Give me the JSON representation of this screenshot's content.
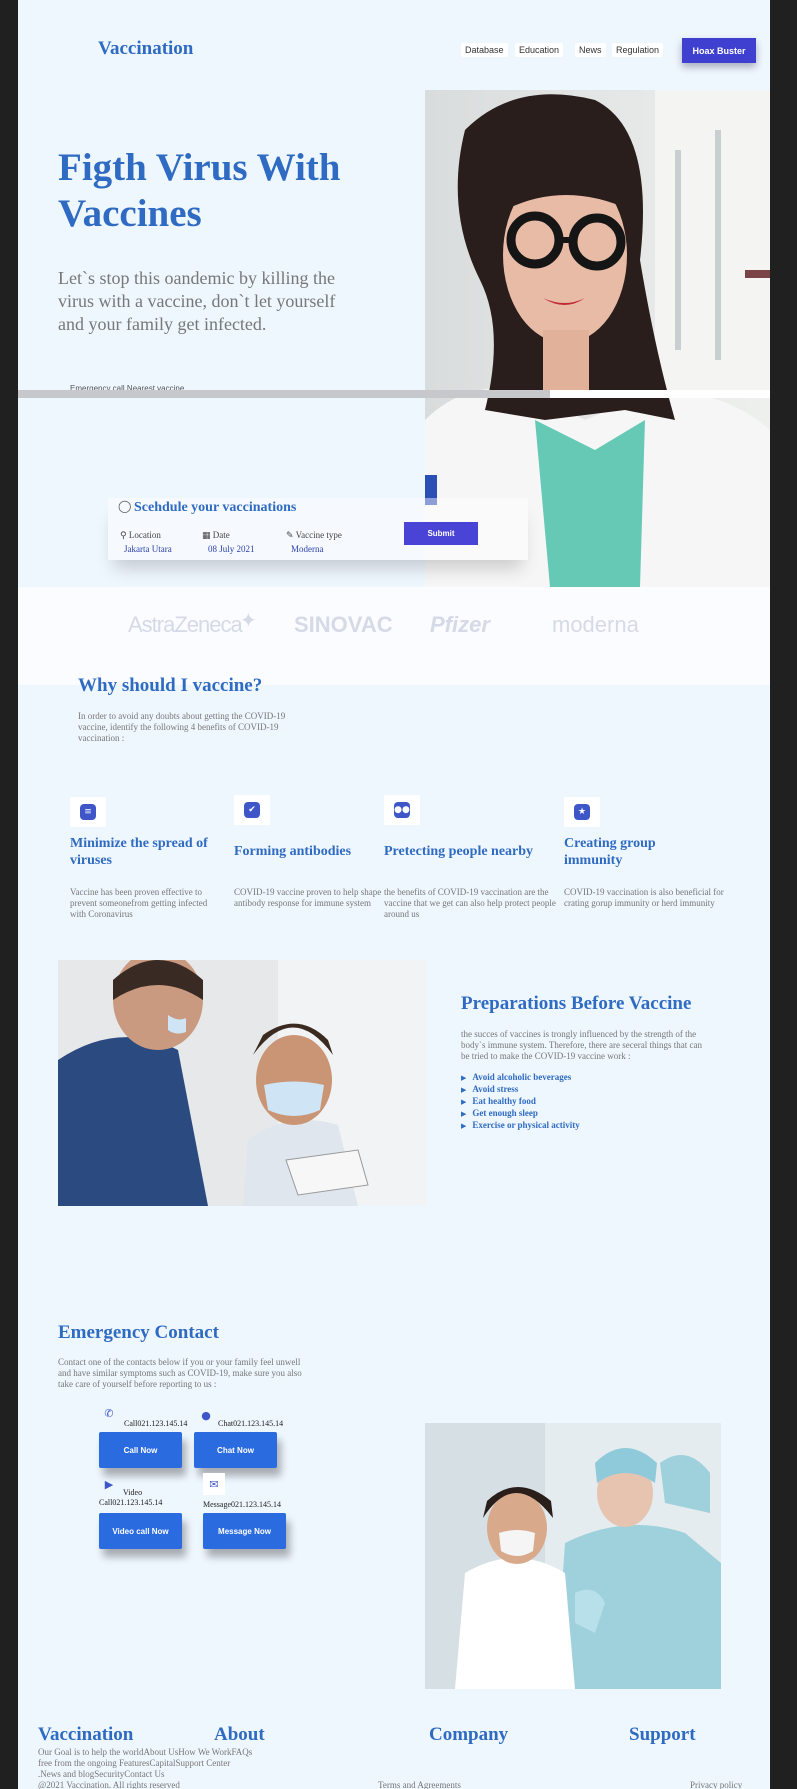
{
  "nav": {
    "logo": "Vaccination",
    "links": [
      "Database",
      "Education",
      "News",
      "Regulation"
    ],
    "cta": "Hoax Buster"
  },
  "hero": {
    "title": "Figth Virus With Vaccines",
    "subtitle": "Let`s stop this oandemic by killing the virus with a vaccine, don`t let yourself and your family get infected.",
    "hidden_line": "Emergency  call     Nearest vaccine"
  },
  "schedule": {
    "title": "Scehdule your vaccinations",
    "fields": [
      {
        "label": "Location",
        "value": "Jakarta Utara",
        "icon": "map-pin-icon"
      },
      {
        "label": "Date",
        "value": "08 July 2021",
        "icon": "calendar-icon"
      },
      {
        "label": "Vaccine type",
        "value": "Moderna",
        "icon": "pencil-icon"
      }
    ],
    "submit": "Submit"
  },
  "brands": [
    "AstraZeneca",
    "SINOVAC",
    "Pfizer",
    "moderna"
  ],
  "why": {
    "title": "Why should I vaccine?",
    "text": "In order to avoid any doubts about getting the COVID-19 vaccine, identify the following 4 benefits of COVID-19 vaccination :",
    "benefits": [
      {
        "title": "Minimize the spread of viruses",
        "text": "Vaccine has been proven effective to prevent someonefrom getting infected with Coronavirus"
      },
      {
        "title": "Forming antibodies",
        "text": "COVID-19 vaccine proven to help shape antibody response for immune system"
      },
      {
        "title": "Pretecting people nearby",
        "text": "the benefits of COVID-19 vaccination are the vaccine that we get can also help protect people around us"
      },
      {
        "title": "Creating group immunity",
        "text": "COVID-19 vaccination is also beneficial for crating gorup immunity or herd immunity"
      }
    ]
  },
  "prep": {
    "title": "Preparations Before Vaccine",
    "text": "the succes of vaccines is trongly influenced by the strength of the body`s immune system. Therefore, there are seceral things that can be tried to make the COVID-19 vaccine work :",
    "items": [
      "Avoid alcoholic beverages",
      "Avoid stress",
      "Eat healthy food",
      "Get enough sleep",
      "Exercise or physical activity"
    ]
  },
  "emergency": {
    "title": "Emergency Contact",
    "text": "Contact one of the contacts below if you or your family feel unwell and have similar symptoms such as COVID-19, make sure you also take care of yourself before reporting to us :",
    "contacts": [
      {
        "label": "Call021.123.145.14",
        "button": "Call Now",
        "icon": "phone-icon"
      },
      {
        "label": "Chat021.123.145.14",
        "button": "Chat Now",
        "icon": "chat-icon"
      },
      {
        "label": "Video Call021.123.145.14",
        "button": "Video call Now",
        "icon": "video-icon"
      },
      {
        "label": "Message021.123.145.14",
        "button": "Message Now",
        "icon": "mail-icon"
      }
    ]
  },
  "footer": {
    "brand": "Vaccination",
    "about": "About",
    "company": "Company",
    "support": "Support",
    "text_line1": "Our Goal is to help the worldAbout UsHow We WorkFAQs",
    "text_line2": "free from the ongoing FeaturesCapitalSupport Center",
    "text_line3": ".News and blogSecurityContact Us",
    "text_line4": "@2021 Vaccination. All rights reserved",
    "terms": "Terms and Agreements",
    "privacy": "Privacy policy"
  },
  "colors": {
    "primary": "#2f6bc2",
    "button": "#4040d0",
    "background": "#eef6fe"
  }
}
